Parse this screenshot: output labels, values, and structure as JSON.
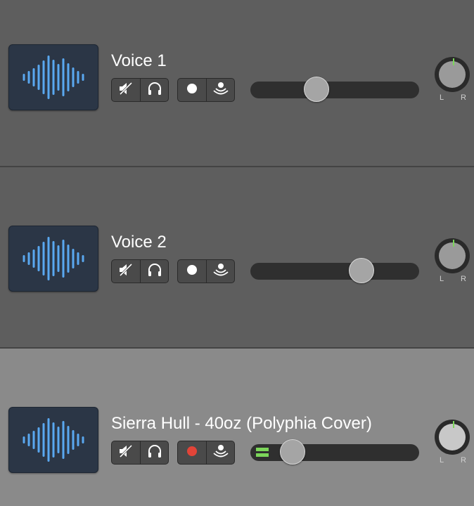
{
  "tracks": [
    {
      "name": "Voice 1",
      "volume": 0.39,
      "record_armed": false,
      "meter_active": false,
      "pan_left": "L",
      "pan_right": "R"
    },
    {
      "name": "Voice 2",
      "volume": 0.66,
      "record_armed": false,
      "meter_active": false,
      "pan_left": "L",
      "pan_right": "R"
    },
    {
      "name": "Sierra Hull - 40oz (Polyphia Cover)",
      "volume": 0.25,
      "record_armed": true,
      "meter_active": true,
      "pan_left": "L",
      "pan_right": "R"
    }
  ],
  "icons": {
    "waveform": "waveform-icon",
    "mute": "speaker-mute-icon",
    "solo": "headphones-icon",
    "record": "record-dot-icon",
    "monitor": "input-monitor-icon"
  },
  "colors": {
    "waveform": "#5aa8f0",
    "record_armed": "#e24438",
    "record_idle": "#ffffff",
    "meter": "#7cd65a",
    "knob_indicator": "#7cd65a"
  }
}
